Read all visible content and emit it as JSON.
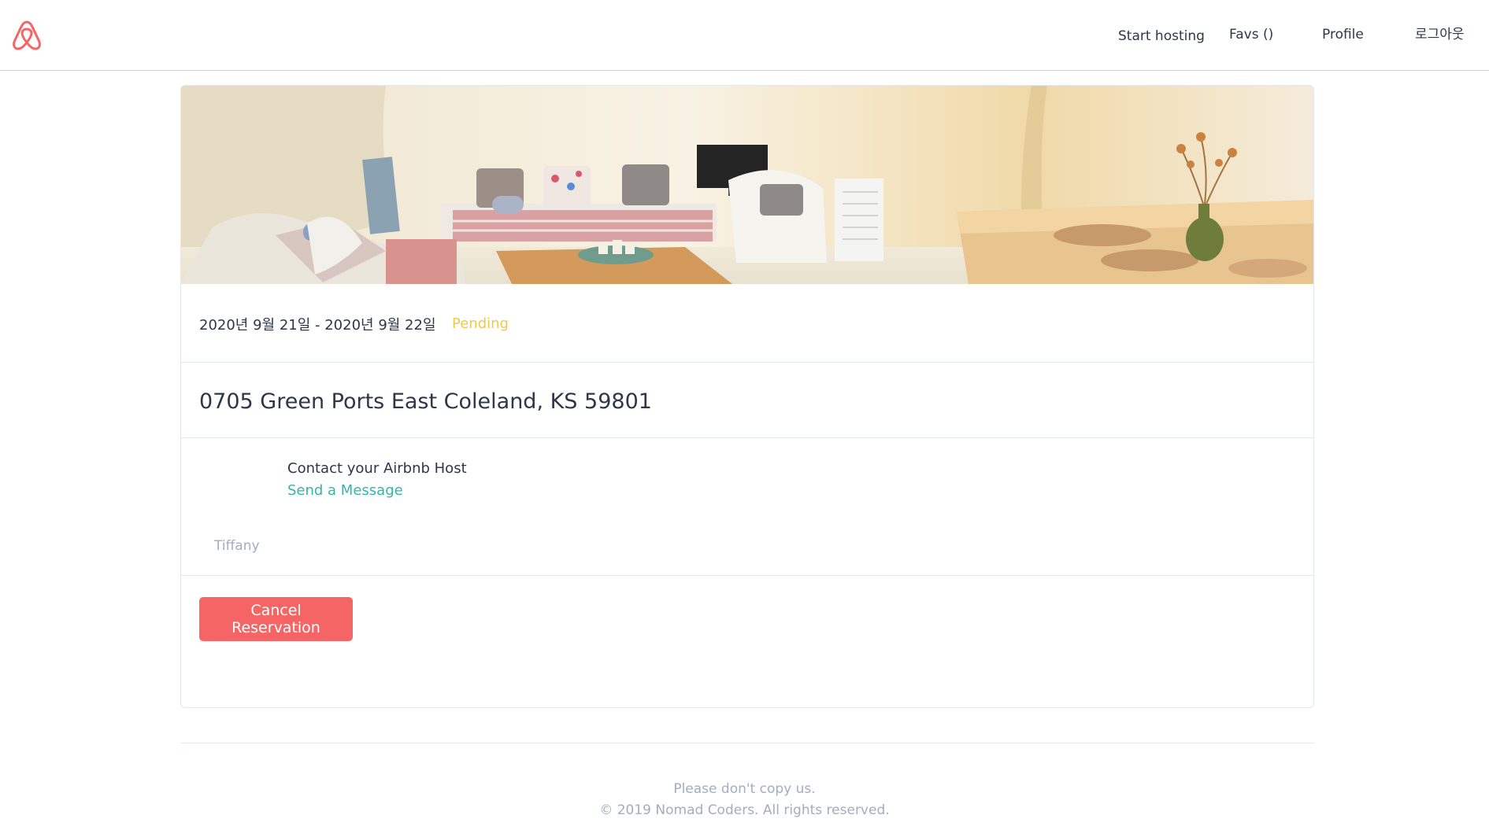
{
  "colors": {
    "brand": "#f56565",
    "pending": "#ecc94b",
    "link": "#38b2ac",
    "muted": "#a0aec0",
    "text": "#2d3748"
  },
  "nav": {
    "logo_icon": "airbnb-logo-icon",
    "links": {
      "start_hosting": "Start hosting",
      "favs": "Favs ()",
      "profile": "Profile",
      "logout": "로그아웃"
    }
  },
  "reservation": {
    "dates": "2020년 9월 21일 - 2020년 9월 22일",
    "status": "Pending",
    "address": "0705 Green Ports East Coleland, KS 59801",
    "host": {
      "contact_title": "Contact your Airbnb Host",
      "send_message": "Send a Message",
      "name": "Tiffany"
    },
    "cancel_label": "Cancel Reservation"
  },
  "footer": {
    "line1": "Please don't copy us.",
    "line2": "© 2019 Nomad Coders. All rights reserved."
  }
}
